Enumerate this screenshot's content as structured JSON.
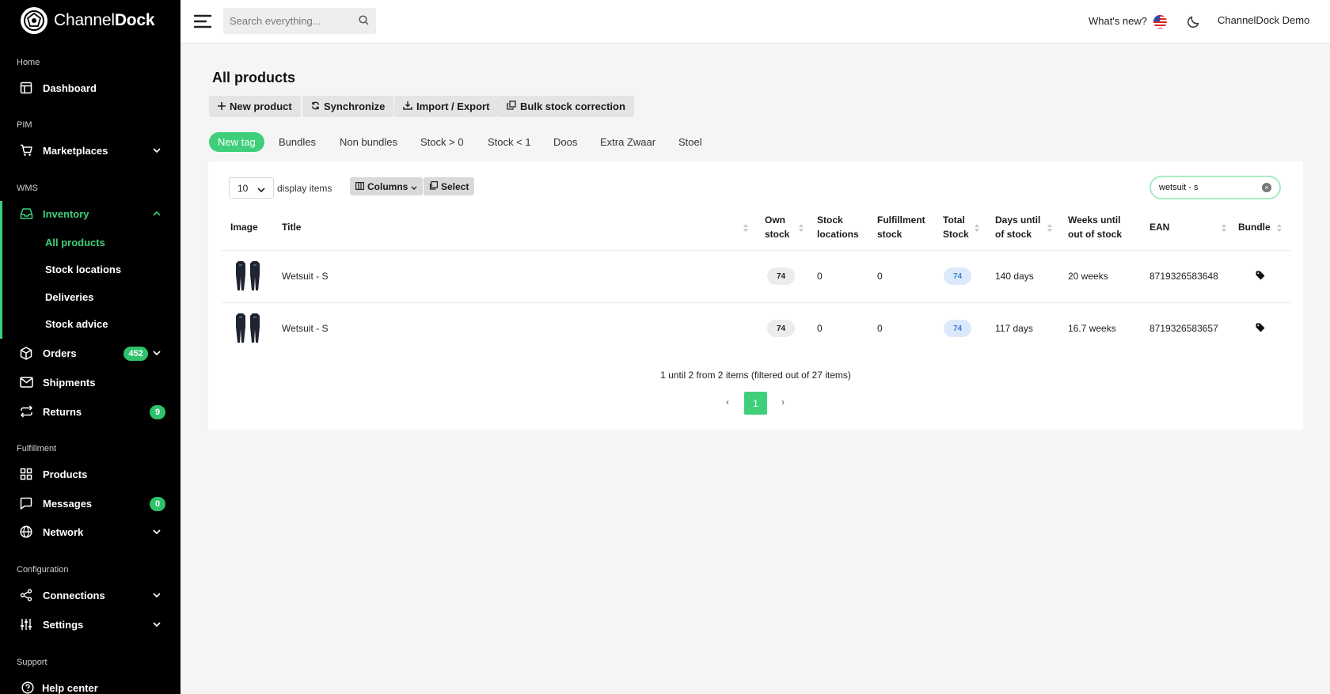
{
  "app": {
    "brand_light": "Channel",
    "brand_bold": "Dock",
    "accent_color": "#3fcf7b"
  },
  "sidebar": {
    "sections": {
      "home": "Home",
      "pim": "PIM",
      "wms": "WMS",
      "fulfillment": "Fulfillment",
      "configuration": "Configuration",
      "support": "Support"
    },
    "items": {
      "dashboard": "Dashboard",
      "marketplaces": "Marketplaces",
      "inventory": "Inventory",
      "orders": "Orders",
      "shipments": "Shipments",
      "returns": "Returns",
      "products": "Products",
      "messages": "Messages",
      "network": "Network",
      "connections": "Connections",
      "settings": "Settings",
      "help_center": "Help center"
    },
    "inventory_sub": [
      "All products",
      "Stock locations",
      "Deliveries",
      "Stock advice"
    ],
    "badges": {
      "orders": "452",
      "returns": "9",
      "messages": "0"
    }
  },
  "topbar": {
    "search_placeholder": "Search everything...",
    "whats_new": "What's new?",
    "account": "ChannelDock Demo"
  },
  "main": {
    "title": "All products",
    "actions": [
      "New product",
      "Synchronize",
      "Import / Export",
      "Bulk stock correction"
    ],
    "tags": [
      "New tag",
      "Bundles",
      "Non bundles",
      "Stock > 0",
      "Stock < 1",
      "Doos",
      "Extra Zwaar",
      "Stoel"
    ]
  },
  "table": {
    "page_size": "10",
    "display_items": "display items",
    "columns_label": "Columns",
    "select_label": "Select",
    "filter_value": "wetsuit - s",
    "headers": {
      "image": "Image",
      "title": "Title",
      "own_stock_1": "Own",
      "own_stock_2": "stock",
      "stock_locations_1": "Stock",
      "stock_locations_2": "locations",
      "fulfillment_1": "Fulfillment",
      "fulfillment_2": "stock",
      "total_1": "Total",
      "total_2": "Stock",
      "days_1": "Days until",
      "days_2": "of stock",
      "weeks_1": "Weeks until",
      "weeks_2": "out of stock",
      "ean": "EAN",
      "bundle": "Bundle"
    },
    "rows": [
      {
        "title": "Wetsuit - S",
        "own_stock": "74",
        "stock_locations": "0",
        "fulfillment_stock": "0",
        "total_stock": "74",
        "days_until": "140 days",
        "weeks_until": "20 weeks",
        "ean": "8719326583648"
      },
      {
        "title": "Wetsuit - S",
        "own_stock": "74",
        "stock_locations": "0",
        "fulfillment_stock": "0",
        "total_stock": "74",
        "days_until": "117 days",
        "weeks_until": "16.7 weeks",
        "ean": "8719326583657"
      }
    ],
    "summary": "1 until 2 from 2 items (filtered out of 27 items)",
    "current_page": "1"
  }
}
